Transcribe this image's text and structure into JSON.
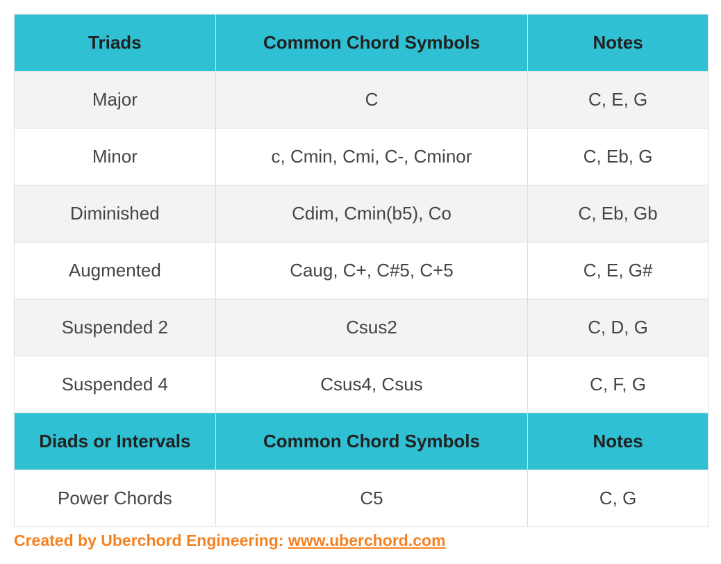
{
  "headers1": {
    "col1": "Triads",
    "col2": "Common Chord Symbols",
    "col3": "Notes"
  },
  "triads": [
    {
      "name": "Major",
      "symbols": "C",
      "notes": "C, E, G"
    },
    {
      "name": "Minor",
      "symbols": "c, Cmin, Cmi, C-, Cminor",
      "notes": "C, Eb, G"
    },
    {
      "name": "Diminished",
      "symbols": "Cdim, Cmin(b5), Co",
      "notes": "C, Eb, Gb"
    },
    {
      "name": "Augmented",
      "symbols": "Caug, C+, C#5, C+5",
      "notes": "C, E, G#"
    },
    {
      "name": "Suspended 2",
      "symbols": "Csus2",
      "notes": "C, D, G"
    },
    {
      "name": "Suspended 4",
      "symbols": "Csus4, Csus",
      "notes": "C, F, G"
    }
  ],
  "headers2": {
    "col1": "Diads or Intervals",
    "col2": "Common Chord Symbols",
    "col3": "Notes"
  },
  "diads": [
    {
      "name": "Power Chords",
      "symbols": "C5",
      "notes": "C, G"
    }
  ],
  "credit": {
    "prefix": "Created by Uberchord Engineering: ",
    "link_text": "www.uberchord.com"
  }
}
